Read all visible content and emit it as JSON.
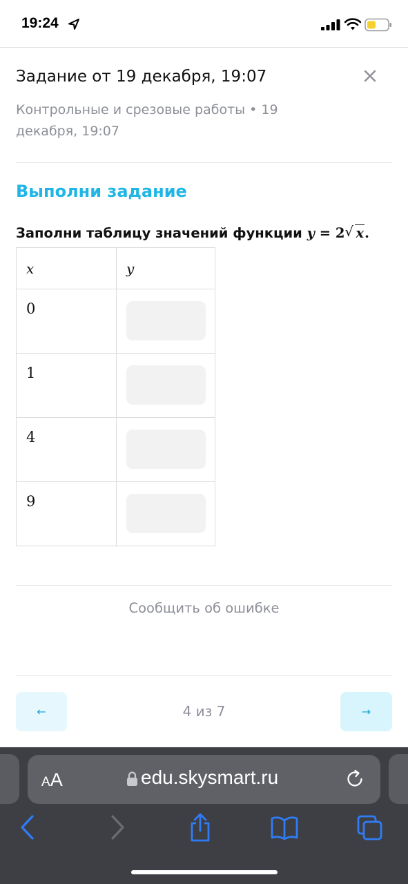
{
  "status_bar": {
    "time": "19:24",
    "icons": [
      "location-arrow-icon",
      "cellular-signal-icon",
      "wifi-icon",
      "battery-icon"
    ]
  },
  "header": {
    "title": "Задание от 19 декабря, 19:07",
    "subtitle": "Контрольные и срезовые работы • 19 декабря, 19:07",
    "close_icon": "close-icon"
  },
  "task": {
    "heading": "Выполни задание",
    "instruction": "Заполни таблицу значений функции",
    "formula": {
      "lhs": "y",
      "eq": "=",
      "coef": "2",
      "radicand": "x",
      "end": "."
    },
    "table": {
      "columns": [
        "x",
        "y"
      ],
      "rows": [
        {
          "x": "0",
          "y": ""
        },
        {
          "x": "1",
          "y": ""
        },
        {
          "x": "4",
          "y": ""
        },
        {
          "x": "9",
          "y": ""
        }
      ]
    }
  },
  "footer": {
    "report_label": "Сообщить об ошибке",
    "pager": "4 из 7",
    "prev_arrow": "←",
    "next_arrow": "→"
  },
  "browser": {
    "text_size_small": "A",
    "text_size_big": "A",
    "url": "edu.skysmart.ru",
    "toolbar": [
      "back-icon",
      "forward-icon",
      "share-icon",
      "bookmarks-icon",
      "tabs-icon"
    ]
  },
  "colors": {
    "accent": "#1FB6E6",
    "muted_text": "#8C8F97",
    "input_bg": "#F2F2F3",
    "nav_button_bg": "#E6F8FD",
    "browser_bg": "#3D3F44",
    "ios_blue": "#2F7CF6",
    "battery_yellow": "#F5D130"
  }
}
